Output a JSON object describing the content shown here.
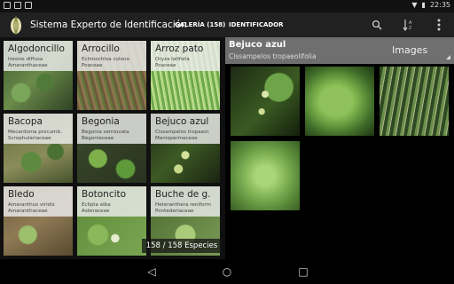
{
  "status": {
    "time": "22:35"
  },
  "app": {
    "title": "Sistema Experto de Identificación",
    "tabs": [
      {
        "label": "GALERÍA (158)",
        "selected": true
      },
      {
        "label": "IDENTIFICADOR",
        "selected": false
      }
    ]
  },
  "gallery": {
    "counter": "158 / 158 Especies",
    "items": [
      {
        "name": "Algodoncillo",
        "scientific": "Iresine diffusa",
        "family": "Amaranthaceae"
      },
      {
        "name": "Arrocillo",
        "scientific": "Echinochloa colona",
        "family": "Poaceae"
      },
      {
        "name": "Arroz pato",
        "scientific": "Oryza latifolia",
        "family": "Poaceae"
      },
      {
        "name": "Bacopa",
        "scientific": "Mecardonia procumb.",
        "family": "Scrophulariaceae"
      },
      {
        "name": "Begonia",
        "scientific": "Begonia semiovata",
        "family": "Begoniaceae"
      },
      {
        "name": "Bejuco azul",
        "scientific": "Cissampelos tropaeol.",
        "family": "Menispermaceae"
      },
      {
        "name": "Bledo",
        "scientific": "Amaranthus viridis",
        "family": "Amaranthaceae"
      },
      {
        "name": "Botoncito",
        "scientific": "Eclipta alba",
        "family": "Asteraceae"
      },
      {
        "name": "Buche de g.",
        "scientific": "Heteranthera reniform",
        "family": "Pontederiaceae"
      }
    ]
  },
  "detail": {
    "name": "Bejuco azul",
    "scientific": "Cissampelos tropaeolifolia",
    "view": "Images"
  }
}
